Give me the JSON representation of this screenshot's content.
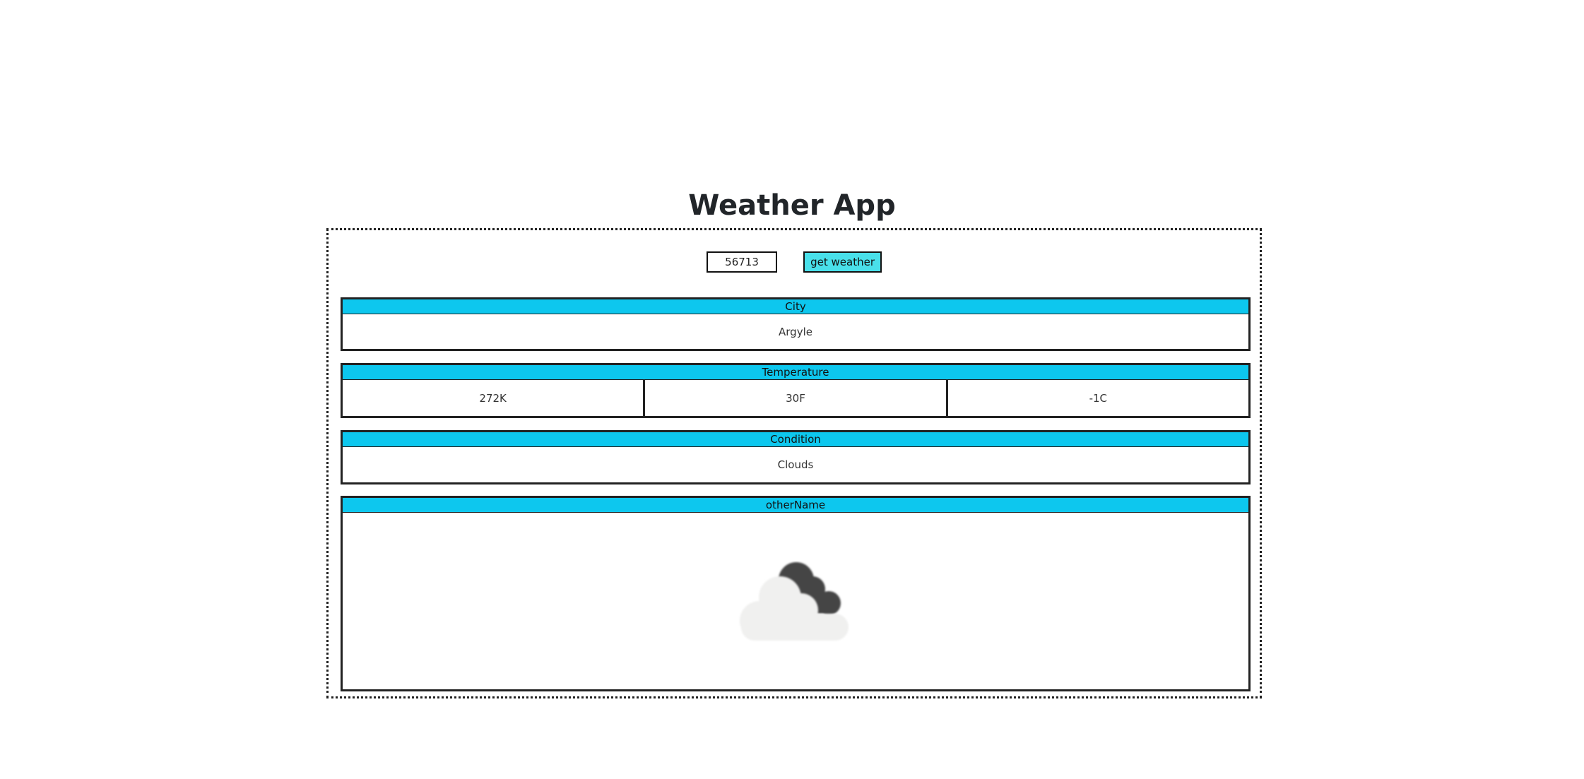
{
  "app": {
    "title": "Weather App"
  },
  "search": {
    "zip_value": "56713",
    "button_label": "get weather"
  },
  "sections": {
    "city": {
      "header": "City",
      "value": "Argyle"
    },
    "temperature": {
      "header": "Temperature",
      "kelvin": "272K",
      "fahrenheit": "30F",
      "celsius": "-1C"
    },
    "condition": {
      "header": "Condition",
      "value": "Clouds"
    },
    "other": {
      "header": "otherName",
      "icon": "broken-clouds-icon"
    }
  },
  "colors": {
    "header_bg": "#0dc7ee",
    "button_bg": "#49e0ea",
    "light_cloud": "#f0f0ef",
    "dark_cloud": "#444444"
  }
}
